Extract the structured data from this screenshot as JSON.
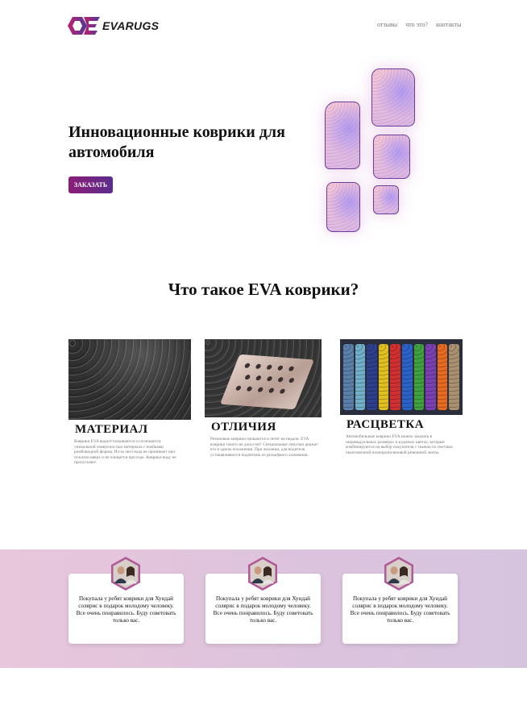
{
  "header": {
    "logo_text": "EVARUGS",
    "nav": [
      "отзывы",
      "что это?",
      "контакты"
    ]
  },
  "hero": {
    "title": "Инновационные коврики для автомобиля",
    "order_button": "ЗАКАЗАТЬ"
  },
  "about": {
    "title": "Что такое EVA коврики?",
    "cards": [
      {
        "title": "МАТЕРИАЛ",
        "text": "Коврики EVA водоотталкиваются и отличаются уникальной поверхностью материала с ячейками ромбовидной формы. Из-за чего вода не проникает при отжатии вверх и не плещется при езде. Коврики воду не пропускают."
      },
      {
        "title": "ОТЛИЧИЯ",
        "text": "Резиновые коврики пачкаются и летят на педали. EVA коврики такого не допустят! Специальные липучки держат его в одном положении. При желании, для водителя устанавливается подпятник из рельефного алюминия."
      },
      {
        "title": "РАСЦВЕТКА",
        "text": "Автомобильные коврики EVA можно заказать в индивидуальных размерах и в разных цветах, которые комбинируются на выбор покупателя с тканью по светлым окантовочной полипропиленовой ремешной ленты."
      }
    ]
  },
  "reviews": [
    {
      "text": "Покупала у ребят коврики для Хундай солярис в подарок молодому человеку. Все очень понравилось. Буду советовать только вас."
    },
    {
      "text": "Покупала у ребят коврики для Хундай солярис в подарок молодому человеку. Все очень понравилось. Буду советовать только вас."
    },
    {
      "text": "Покупала у ребят коврики для Хундай солярис в подарок молодому человеку. Все очень понравилось. Буду советовать только вас."
    }
  ],
  "colors": {
    "accent_start": "#8b1d78",
    "accent_end": "#5b2d8b",
    "mat_outline": "#6a3d9a",
    "review_band": "#e2c5dd"
  }
}
